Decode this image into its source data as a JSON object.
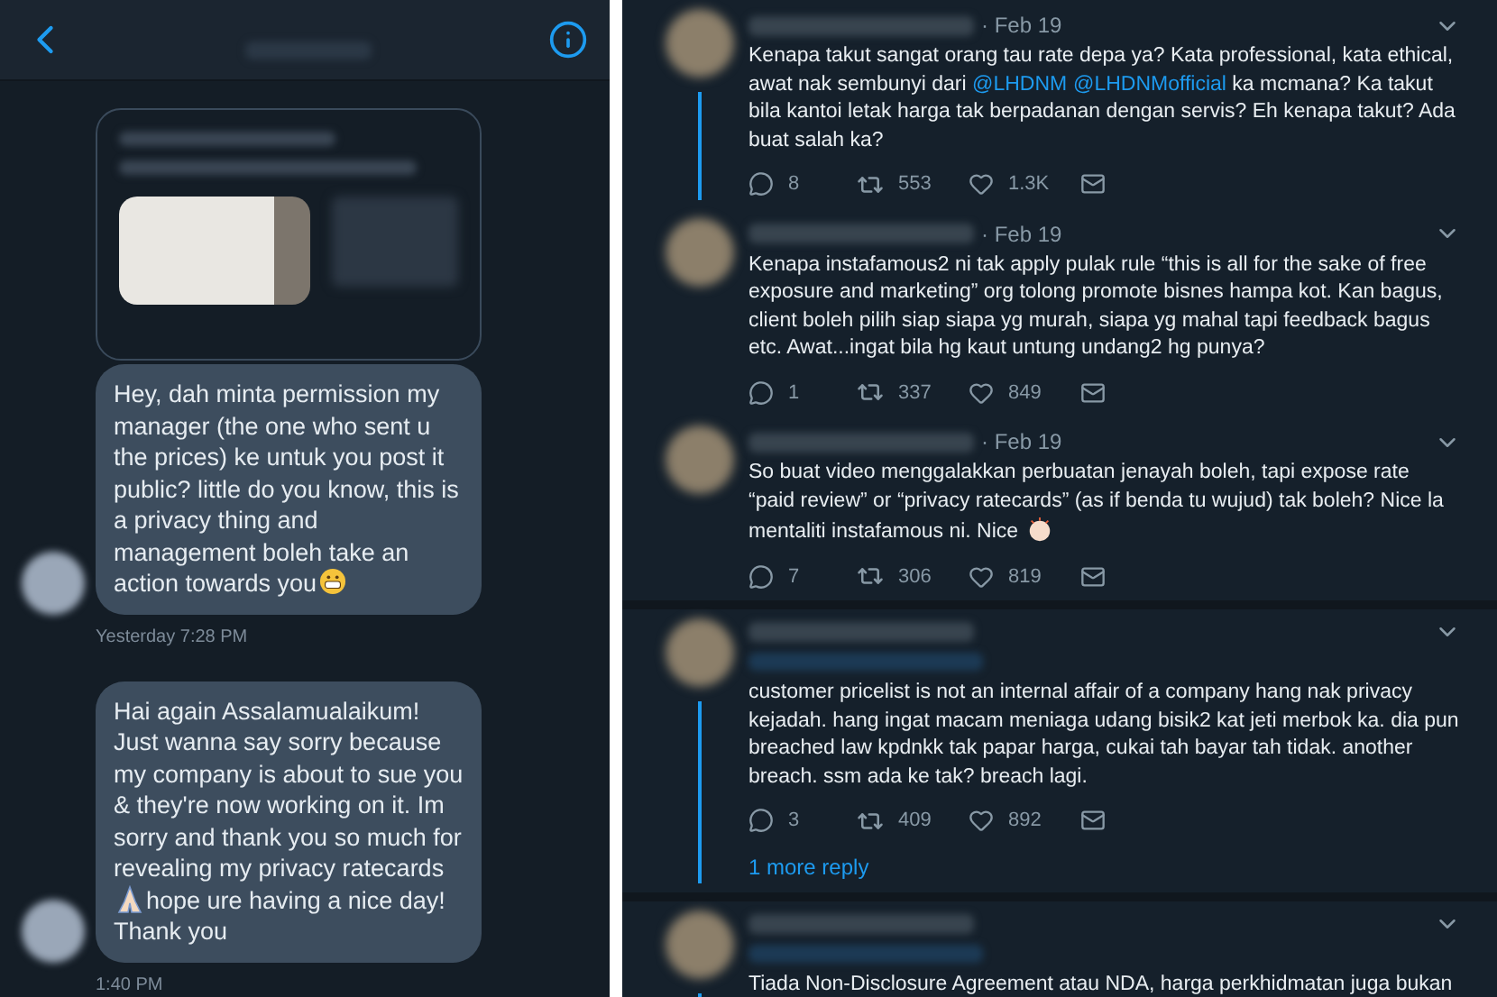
{
  "chat": {
    "messages": [
      {
        "kind": "shared_post"
      },
      {
        "kind": "bubble",
        "parts": [
          {
            "kind": "text",
            "text": "Hey, dah minta permission my manager (the one who sent u the prices) ke untuk you post it public? little do you know, this is a privacy thing and management boleh take an action towards you"
          },
          {
            "kind": "grin"
          }
        ]
      },
      {
        "kind": "time",
        "text": "Yesterday 7:28 PM"
      },
      {
        "kind": "bubble",
        "parts": [
          {
            "kind": "text",
            "text": "Hai again Assalamualaikum! Just wanna say sorry because my company is about to sue you & they're now working on it. Im sorry and thank you so much for revealing my privacy ratecards"
          },
          {
            "kind": "pray"
          },
          {
            "kind": "text",
            "text": "hope ure having a nice day! Thank you"
          }
        ]
      },
      {
        "kind": "time",
        "text": "1:40 PM"
      }
    ]
  },
  "tweets": [
    {
      "date": "· Feb 19",
      "thread_below": true,
      "parts": [
        {
          "kind": "text",
          "text": "Kenapa takut sangat orang tau rate depa ya? Kata professional, kata ethical, awat nak sembunyi dari "
        },
        {
          "kind": "mention",
          "text": "@LHDNM"
        },
        {
          "kind": "mention",
          "text": "@LHDNMofficial"
        },
        {
          "kind": "text",
          "text": " ka mcmana? Ka takut bila kantoi letak harga tak berpadanan dengan servis? Eh kenapa takut? Ada buat salah ka?"
        }
      ],
      "replies": "8",
      "retweets": "553",
      "likes": "1.3K",
      "divider": false
    },
    {
      "date": "· Feb 19",
      "thread_below": false,
      "parts": [
        {
          "kind": "text",
          "text": "Kenapa instafamous2 ni tak apply pulak rule “this is all for the sake of free exposure and marketing” org tolong promote bisnes hampa kot. Kan bagus, client boleh pilih siap siapa yg murah, siapa yg mahal tapi feedback bagus etc. Awat...ingat bila hg kaut untung undang2 hg punya?"
        }
      ],
      "replies": "1",
      "retweets": "337",
      "likes": "849",
      "divider": false
    },
    {
      "date": "· Feb 19",
      "thread_below": false,
      "parts": [
        {
          "kind": "text",
          "text": "So buat video menggalakkan perbuatan jenayah boleh, tapi expose rate “paid review” or “privacy ratecards” (as if benda tu wujud) tak boleh? Nice la mentaliti instafamous ni. Nice"
        },
        {
          "kind": "clap"
        }
      ],
      "replies": "7",
      "retweets": "306",
      "likes": "819",
      "divider": true
    },
    {
      "thread_below": true,
      "parts": [
        {
          "kind": "text",
          "text": "customer pricelist is not an internal affair of a company hang nak privacy kejadah. hang ingat macam meniaga udang bisik2 kat jeti merbok ka. dia pun breached law kpdnkk tak papar harga, cukai tah bayar tah tidak. another breach. ssm ada ke tak? breach lagi."
        }
      ],
      "replies": "3",
      "retweets": "409",
      "likes": "892",
      "more": "1 more reply",
      "divider": true
    },
    {
      "thread_below": true,
      "parts": [
        {
          "kind": "text",
          "text": "Tiada Non-Disclosure Agreement atau NDA, harga perkhidmatan juga bukan"
        }
      ],
      "divider": false
    }
  ]
}
